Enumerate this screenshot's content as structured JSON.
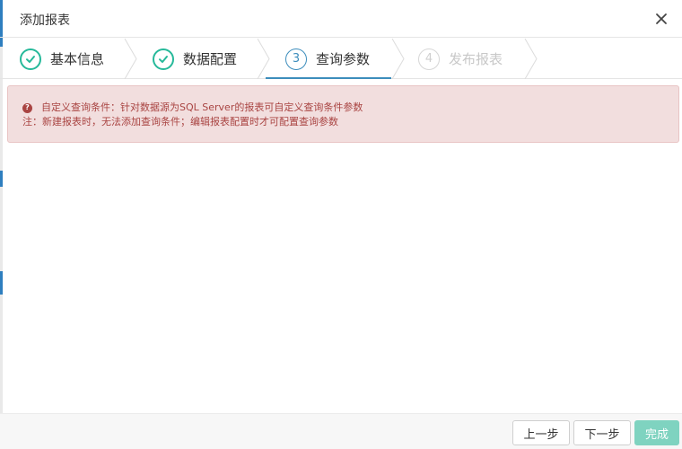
{
  "dialog": {
    "title": "添加报表"
  },
  "steps": [
    {
      "number": "1",
      "label": "基本信息",
      "status": "done"
    },
    {
      "number": "2",
      "label": "数据配置",
      "status": "done"
    },
    {
      "number": "3",
      "label": "查询参数",
      "status": "active"
    },
    {
      "number": "4",
      "label": "发布报表",
      "status": "todo"
    }
  ],
  "alert": {
    "line1": "自定义查询条件：针对数据源为SQL Server的报表可自定义查询条件参数",
    "line2": "注：新建报表时，无法添加查询条件；编辑报表配置时才可配置查询参数"
  },
  "footer": {
    "prev_label": "上一步",
    "next_label": "下一步",
    "finish_label": "完成"
  },
  "colors": {
    "done": "#26b99a",
    "active": "#3c8dbc",
    "todo": "#cfcfcf",
    "alert_bg": "#f2dede",
    "alert_text": "#a94442",
    "finish_bg": "#7fd3c0"
  }
}
